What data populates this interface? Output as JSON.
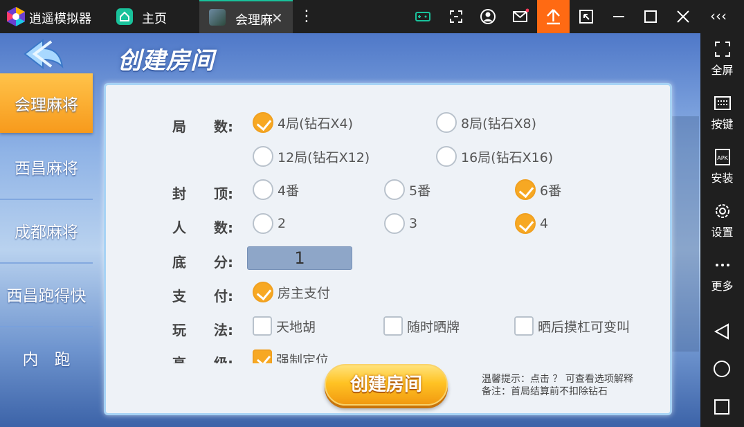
{
  "titlebar": {
    "app_name": "逍遥模拟器",
    "home_label": "主页",
    "tab_label": "会理麻",
    "tab_close": "✕",
    "more": "⋮",
    "collapse": "‹‹‹",
    "accent": "#19c29b",
    "upload_bg": "#ff6a13"
  },
  "sidebar": {
    "items": [
      {
        "label": "全屏",
        "icon": "fullscreen-icon"
      },
      {
        "label": "按键",
        "icon": "keyboard-icon"
      },
      {
        "label": "安装",
        "icon": "apk-icon"
      },
      {
        "label": "设置",
        "icon": "gear-icon"
      },
      {
        "label": "更多",
        "icon": "more-dots-icon"
      }
    ]
  },
  "game": {
    "title": "创建房间",
    "tabs": [
      {
        "label": "会理麻将",
        "active": true
      },
      {
        "label": "西昌麻将",
        "active": false
      },
      {
        "label": "成都麻将",
        "active": false
      },
      {
        "label": "西昌跑得快",
        "active": false
      },
      {
        "label": "内　跑",
        "active": false
      }
    ],
    "form": {
      "rounds_label": "局　　数:",
      "rounds": [
        {
          "label": "4局(钻石X4)",
          "checked": true
        },
        {
          "label": "8局(钻石X8)",
          "checked": false
        },
        {
          "label": "12局(钻石X12)",
          "checked": false
        },
        {
          "label": "16局(钻石X16)",
          "checked": false
        }
      ],
      "cap_label": "封　　顶:",
      "cap": [
        {
          "label": "4番",
          "checked": false
        },
        {
          "label": "5番",
          "checked": false
        },
        {
          "label": "6番",
          "checked": true
        }
      ],
      "players_label": "人　　数:",
      "players": [
        {
          "label": "2",
          "checked": false
        },
        {
          "label": "3",
          "checked": false
        },
        {
          "label": "4",
          "checked": true
        }
      ],
      "score_label": "底　　分:",
      "score_value": "1",
      "pay_label": "支　　付:",
      "pay": [
        {
          "label": "房主支付",
          "checked": true
        }
      ],
      "rules_label": "玩　　法:",
      "rules": [
        {
          "label": "天地胡",
          "checked": false
        },
        {
          "label": "随时晒牌",
          "checked": false
        },
        {
          "label": "晒后摸杠可变叫",
          "checked": false
        }
      ],
      "advanced_label": "高　　级:",
      "advanced": [
        {
          "label": "强制定位",
          "checked": true
        }
      ]
    },
    "create_button": "创建房间",
    "tip_line1": "温馨提示：点击 ？ 可查看选项解释",
    "tip_line2": "备注：首局结算前不扣除钻石"
  }
}
